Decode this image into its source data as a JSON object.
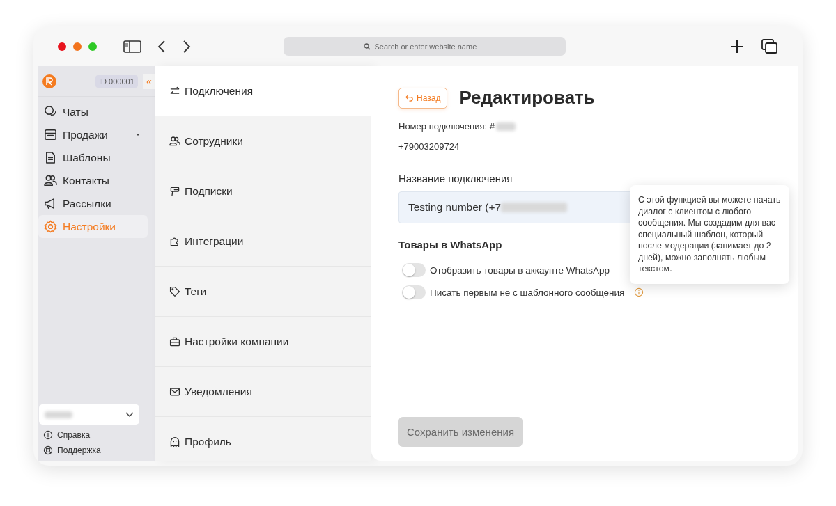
{
  "browser": {
    "address_placeholder": "Search or enter website name"
  },
  "sidebar": {
    "account_id": "ID 000001",
    "collapse": "«",
    "items": [
      {
        "label": "Чаты",
        "selected": false,
        "has_caret": false
      },
      {
        "label": "Продажи",
        "selected": false,
        "has_caret": true
      },
      {
        "label": "Шаблоны",
        "selected": false,
        "has_caret": false
      },
      {
        "label": "Контакты",
        "selected": false,
        "has_caret": false
      },
      {
        "label": "Рассылки",
        "selected": false,
        "has_caret": false
      },
      {
        "label": "Настройки",
        "selected": true,
        "has_caret": false
      }
    ],
    "footer_links": [
      {
        "label": "Справка"
      },
      {
        "label": "Поддержка"
      }
    ]
  },
  "settings_menu": [
    {
      "label": "Подключения",
      "selected": true
    },
    {
      "label": "Сотрудники",
      "selected": false
    },
    {
      "label": "Подписки",
      "selected": false
    },
    {
      "label": "Интеграции",
      "selected": false
    },
    {
      "label": "Теги",
      "selected": false
    },
    {
      "label": "Настройки компании",
      "selected": false
    },
    {
      "label": "Уведомления",
      "selected": false
    },
    {
      "label": "Профиль",
      "selected": false
    }
  ],
  "content": {
    "back_button": "Назад",
    "title": "Редактировать",
    "connection_number_label": "Номер подключения: #",
    "phone": "+79003209724",
    "name_label": "Название подключения",
    "name_value": "Testing number (+7",
    "section_title": "Товары в WhatsApp",
    "toggles": [
      {
        "label": "Отобразить товары в аккаунте WhatsApp",
        "on": false,
        "has_info": false
      },
      {
        "label": "Писать первым не с шаблонного сообщения",
        "on": false,
        "has_info": true
      }
    ],
    "tooltip": "С этой функцией вы можете начать диалог с клиентом с любого сообщения. Мы создадим для вас специальный шаблон, который после модерации (занимает до 2 дней), можно заполнять любым текстом.",
    "save_button": {
      "label": "Сохранить изменения",
      "disabled": true
    }
  }
}
